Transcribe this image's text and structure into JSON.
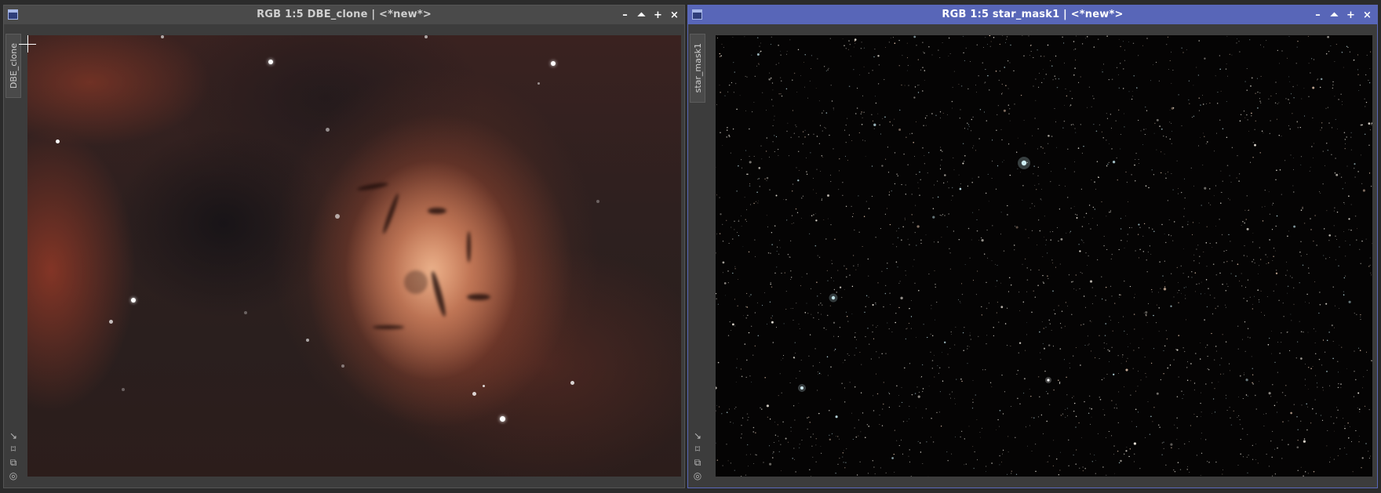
{
  "windows": [
    {
      "title": "RGB 1:5 DBE_clone | <*new*>",
      "tab_label": "DBE_clone",
      "active": false
    },
    {
      "title": "RGB 1:5 star_mask1 | <*new*>",
      "tab_label": "star_mask1",
      "active": true
    }
  ],
  "controls": {
    "minimize": "–",
    "shade": "⏶",
    "maximize": "+",
    "close": "×"
  },
  "icons": {
    "window": "window-icon",
    "minimize": "minimize-icon",
    "shade": "shade-icon",
    "maximize": "maximize-icon",
    "close": "close-icon",
    "tools": [
      "arrow-tool-icon",
      "fit-view-icon",
      "new-window-icon",
      "target-icon"
    ]
  },
  "colors": {
    "active_titlebar": "#5866b8",
    "inactive_titlebar": "#4a4a4a",
    "workspace": "#2b2b2b"
  }
}
